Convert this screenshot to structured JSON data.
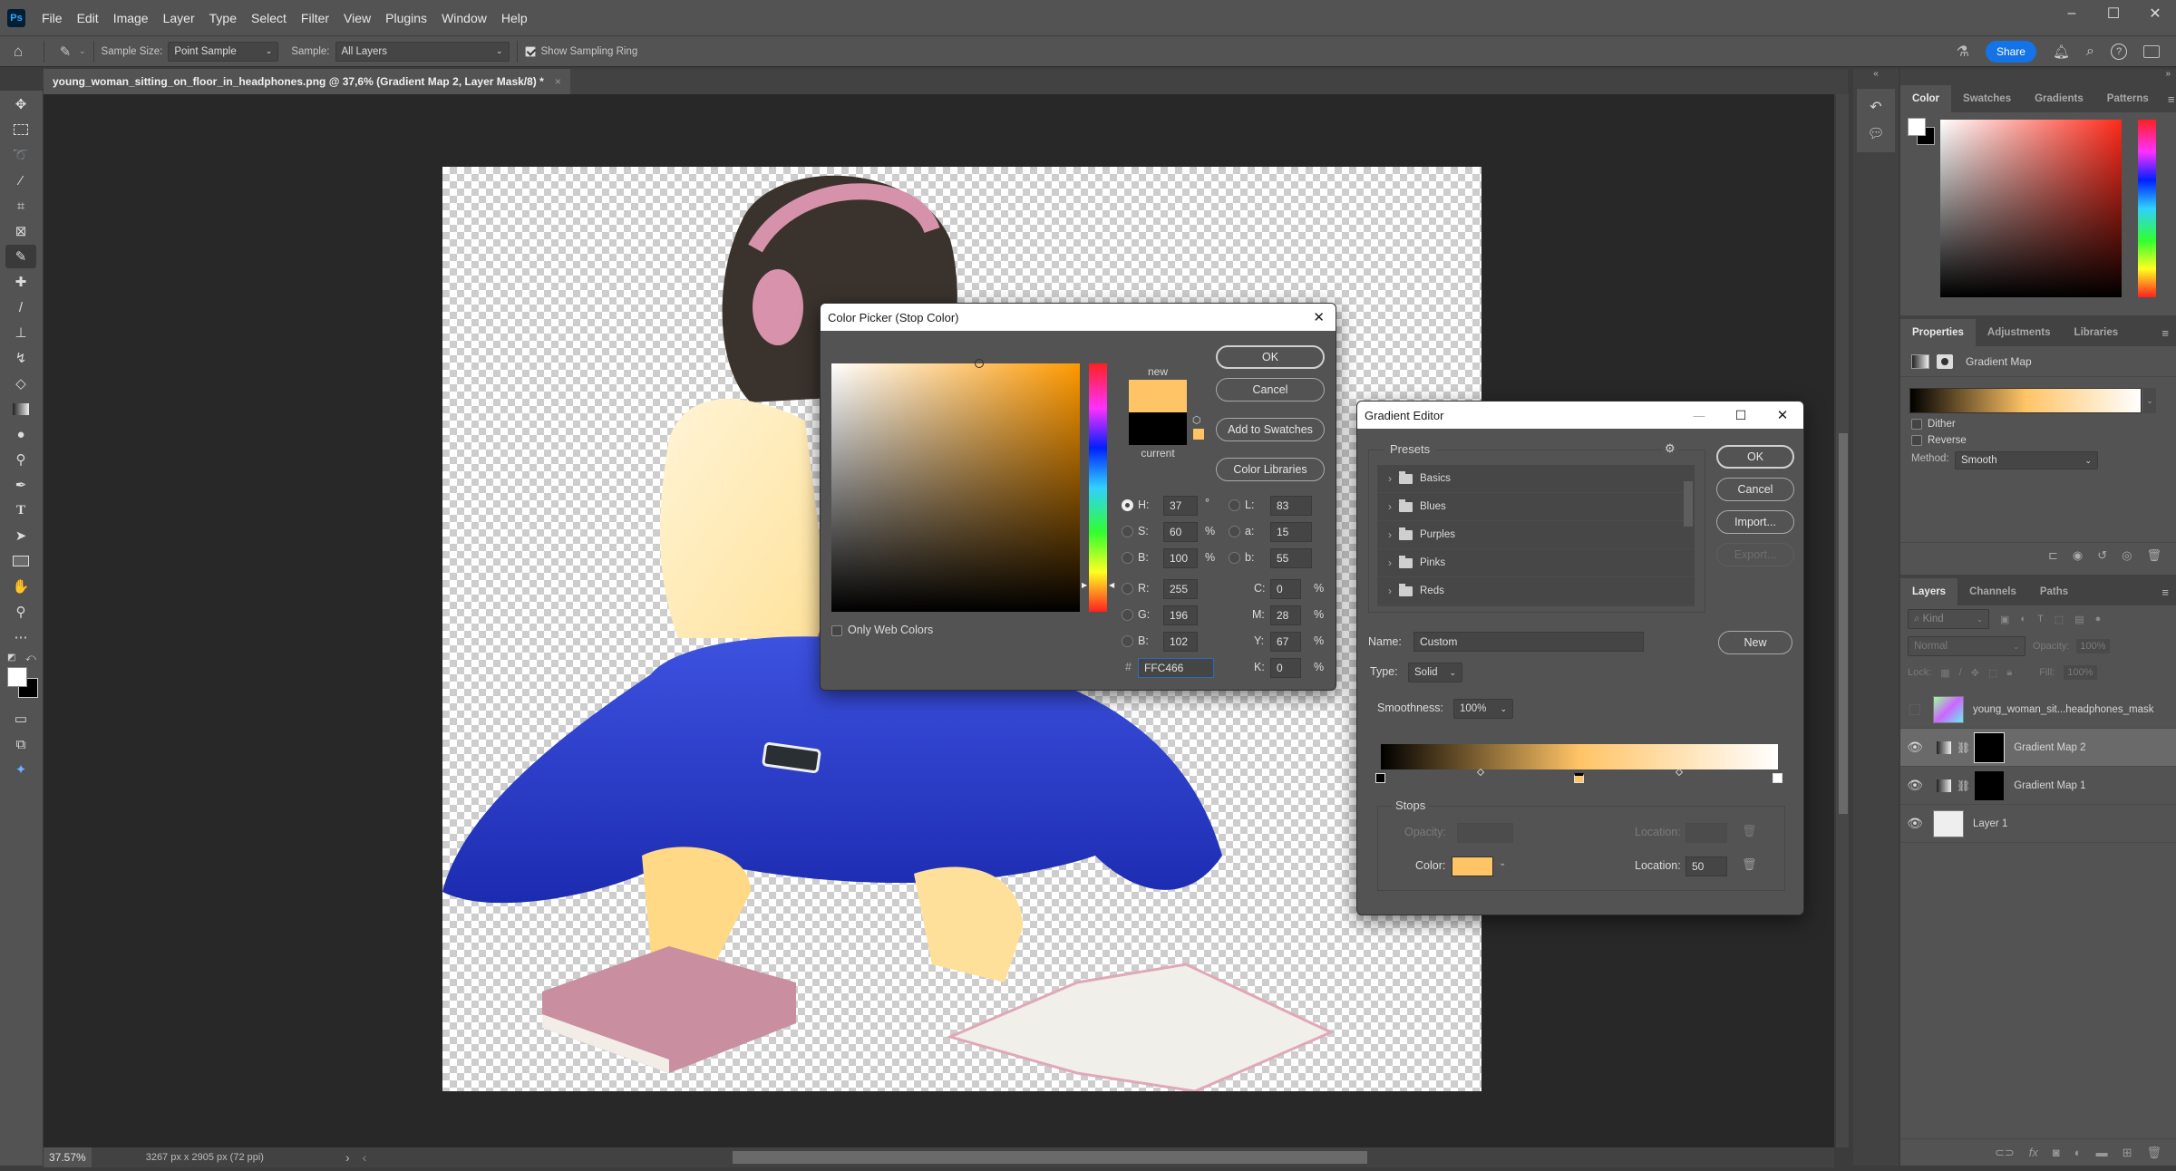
{
  "app": {
    "logo": "Ps",
    "menu": [
      "File",
      "Edit",
      "Image",
      "Layer",
      "Type",
      "Select",
      "Filter",
      "View",
      "Plugins",
      "Window",
      "Help"
    ]
  },
  "window_controls": {
    "minimize": "–",
    "maximize": "☐",
    "close": "✕"
  },
  "options_bar": {
    "sample_size_label": "Sample Size:",
    "sample_size_value": "Point Sample",
    "sample_label": "Sample:",
    "sample_value": "All Layers",
    "show_sampling_ring_label": "Show Sampling Ring",
    "show_sampling_ring_checked": true,
    "share_label": "Share"
  },
  "document": {
    "tab_title": "young_woman_sitting_on_floor_in_headphones.png @ 37,6% (Gradient Map 2, Layer Mask/8) *",
    "tab_close": "×"
  },
  "status_bar": {
    "zoom": "37.57%",
    "doc_info": "3267 px x 2905 px (72 ppi)",
    "arrow": "›",
    "scroll_left": "‹"
  },
  "tools": [
    "move",
    "rectangular-marquee",
    "lasso",
    "magic-wand",
    "crop",
    "frame",
    "eyedropper",
    "healing-brush",
    "brush",
    "clone-stamp",
    "history-brush",
    "eraser",
    "gradient",
    "blur",
    "dodge",
    "pen",
    "type",
    "path-selection",
    "rectangle",
    "hand",
    "zoom",
    "more-tools"
  ],
  "color_panel": {
    "tabs": [
      "Color",
      "Swatches",
      "Gradients",
      "Patterns"
    ],
    "active_tab": "Color",
    "foreground": "#ffffff",
    "background": "#000000",
    "hue_color": "#ff2a1a"
  },
  "properties_panel": {
    "tabs": [
      "Properties",
      "Adjustments",
      "Libraries"
    ],
    "active_tab": "Properties",
    "layer_type": "Gradient Map",
    "dither_label": "Dither",
    "dither_checked": false,
    "reverse_label": "Reverse",
    "reverse_checked": false,
    "method_label": "Method:",
    "method_value": "Smooth"
  },
  "layers_panel": {
    "tabs": [
      "Layers",
      "Channels",
      "Paths"
    ],
    "active_tab": "Layers",
    "filter_placeholder": "Kind",
    "blend_mode": "Normal",
    "opacity_label": "Opacity:",
    "opacity_value": "100%",
    "lock_label": "Lock:",
    "fill_label": "Fill:",
    "fill_value": "100%",
    "layers": [
      {
        "name": "young_woman_sit...headphones_mask",
        "visible": false,
        "selected": false,
        "kind": "smart-object"
      },
      {
        "name": "Gradient Map 2",
        "visible": true,
        "selected": true,
        "kind": "adjustment"
      },
      {
        "name": "Gradient Map 1",
        "visible": true,
        "selected": false,
        "kind": "adjustment"
      },
      {
        "name": "Layer 1",
        "visible": true,
        "selected": false,
        "kind": "pixel"
      }
    ]
  },
  "color_picker": {
    "title": "Color Picker (Stop Color)",
    "ok": "OK",
    "cancel": "Cancel",
    "add_to_swatches": "Add to Swatches",
    "color_libraries": "Color Libraries",
    "new_label": "new",
    "current_label": "current",
    "new_color": "#ffc466",
    "current_color": "#000000",
    "only_web_colors": "Only Web Colors",
    "only_web_checked": false,
    "selected_mode": "H",
    "fields": {
      "H": {
        "label": "H:",
        "value": "37",
        "unit": "°"
      },
      "S": {
        "label": "S:",
        "value": "60",
        "unit": "%"
      },
      "B": {
        "label": "B:",
        "value": "100",
        "unit": "%"
      },
      "R": {
        "label": "R:",
        "value": "255"
      },
      "G": {
        "label": "G:",
        "value": "196"
      },
      "Bl": {
        "label": "B:",
        "value": "102"
      },
      "L": {
        "label": "L:",
        "value": "83"
      },
      "a": {
        "label": "a:",
        "value": "15"
      },
      "b": {
        "label": "b:",
        "value": "55"
      },
      "C": {
        "label": "C:",
        "value": "0",
        "unit": "%"
      },
      "M": {
        "label": "M:",
        "value": "28",
        "unit": "%"
      },
      "Y": {
        "label": "Y:",
        "value": "67",
        "unit": "%"
      },
      "K": {
        "label": "K:",
        "value": "0",
        "unit": "%"
      }
    },
    "hex_label": "#",
    "hex_value": "FFC466"
  },
  "gradient_editor": {
    "title": "Gradient Editor",
    "presets_label": "Presets",
    "presets": [
      "Basics",
      "Blues",
      "Purples",
      "Pinks",
      "Reds"
    ],
    "ok": "OK",
    "cancel": "Cancel",
    "import": "Import...",
    "export": "Export...",
    "name_label": "Name:",
    "name_value": "Custom",
    "new": "New",
    "type_label": "Type:",
    "type_value": "Solid",
    "smoothness_label": "Smoothness:",
    "smoothness_value": "100%",
    "stops_label": "Stops",
    "opacity_label": "Opacity:",
    "location_label": "Location:",
    "color_label": "Color:",
    "stop_color": "#ffc466",
    "color_location": "50",
    "color_stops": [
      {
        "location": 0,
        "color": "#000000"
      },
      {
        "location": 50,
        "color": "#ffc466"
      },
      {
        "location": 100,
        "color": "#ffffff"
      }
    ],
    "midpoints": [
      25,
      75
    ]
  }
}
